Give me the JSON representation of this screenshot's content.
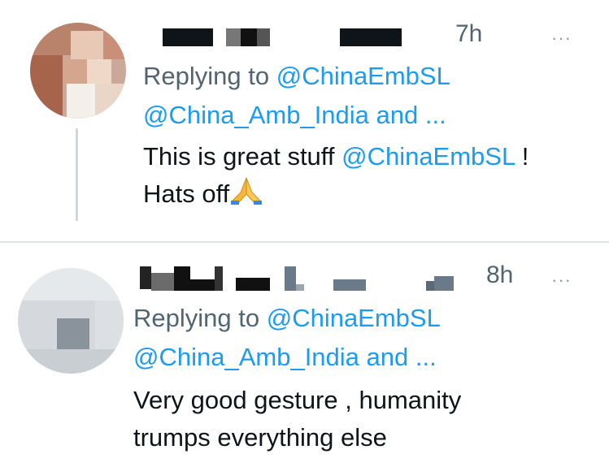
{
  "tweets": [
    {
      "time": "7h",
      "replying_prefix": "Replying to ",
      "replying_handle": "@ChinaEmbSL",
      "also_replying": "@China_Amb_India and ...",
      "body_line1_text": "This is great stuff ",
      "body_line1_mention": "@ChinaEmbSL",
      "body_line1_end": " !",
      "body_line2_text": "Hats off",
      "emoji_icon": "folded-hands-emoji"
    },
    {
      "time": "8h",
      "replying_prefix": "Replying to ",
      "replying_handle": "@ChinaEmbSL",
      "also_replying": "@China_Amb_India and ...",
      "body_line1_text": "Very good gesture , humanity",
      "body_line2_text": "trumps everything else"
    }
  ],
  "more_icon_glyph": "···",
  "colors": {
    "mention": "#1d9bf0",
    "secondary_text": "#536471",
    "primary_text": "#0f1419",
    "divider": "#e1e5e8"
  }
}
